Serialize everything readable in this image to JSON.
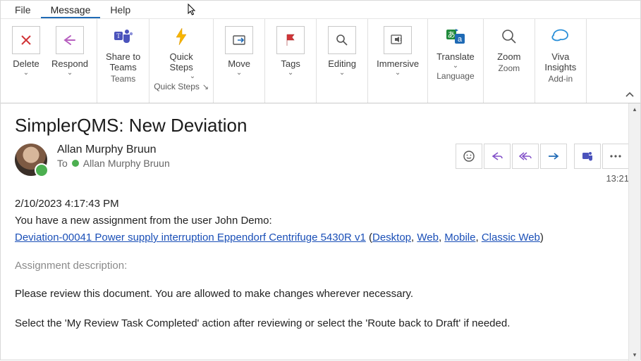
{
  "menu": {
    "file": "File",
    "message": "Message",
    "help": "Help"
  },
  "ribbon": {
    "delete": "Delete",
    "respond": "Respond",
    "shareTeams": "Share to\nTeams",
    "quickSteps": "Quick\nSteps",
    "move": "Move",
    "tags": "Tags",
    "editing": "Editing",
    "immersive": "Immersive",
    "translate": "Translate",
    "zoom": "Zoom",
    "viva": "Viva\nInsights",
    "groups": {
      "teams": "Teams",
      "quickSteps": "Quick Steps",
      "language": "Language",
      "zoom": "Zoom",
      "addin": "Add-in"
    }
  },
  "email": {
    "subject": "SimplerQMS: New Deviation",
    "from": "Allan Murphy Bruun",
    "toLabel": "To",
    "toName": "Allan Murphy Bruun",
    "time": "13:21",
    "dateLine": "2/10/2023 4:17:43 PM",
    "assignLine": "You have a new assignment from the user John Demo:",
    "linkText": "Deviation-00041 Power supply interruption Eppendorf Centrifuge 5430R v1",
    "open": "(",
    "close": ")",
    "desktop": "Desktop",
    "web": "Web",
    "mobile": "Mobile",
    "classic": "Classic Web",
    "sep": ", ",
    "descLabel": "Assignment description:",
    "body1": "Please review this document. You are allowed to make changes wherever necessary.",
    "body2": "Select the 'My Review Task Completed' action after reviewing or select the 'Route back to Draft' if needed."
  }
}
